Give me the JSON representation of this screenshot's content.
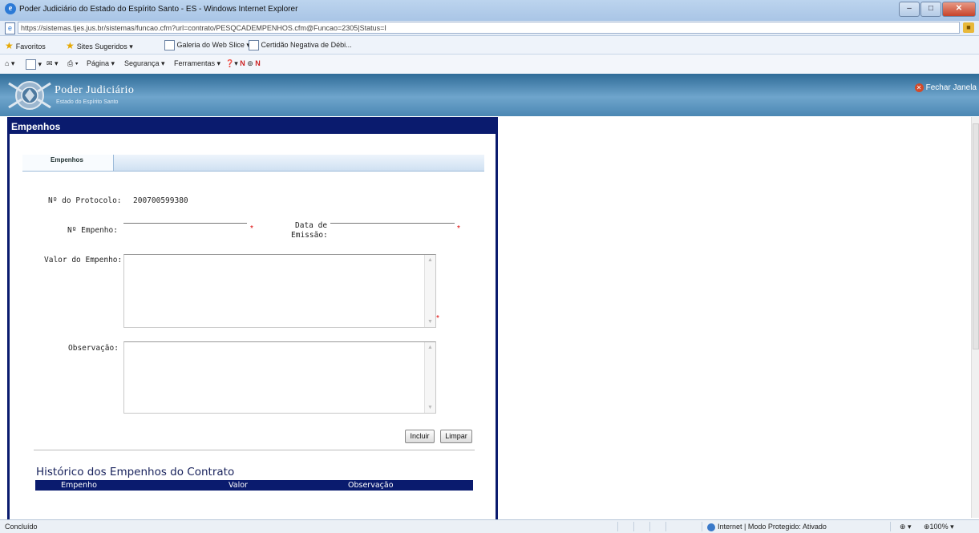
{
  "browser": {
    "window_title": "Poder Judiciário do Estado do Espírito Santo - ES - Windows Internet Explorer",
    "url": "https://sistemas.tjes.jus.br/sistemas/funcao.cfm?url=contrato/PESQCADEMPENHOS.cfm@Funcao=2305|Status=I",
    "favorites": {
      "label": "Favoritos",
      "items": [
        "Sites Sugeridos ▾",
        "Galeria do Web Slice ▾",
        "Certidão Negativa de Débi..."
      ]
    },
    "command": {
      "pagina": "Página ▾",
      "seguranca": "Segurança ▾",
      "ferramentas": "Ferramentas ▾"
    },
    "status": {
      "left": "Concluído",
      "zone": "Internet | Modo Protegido: Ativado",
      "zoom": "100%"
    }
  },
  "app": {
    "title": "Poder Judiciário",
    "subtitle": "Estado do Espírito Santo",
    "close_label": "Fechar Janela"
  },
  "panel": {
    "title": "Empenhos",
    "tab": "Empenhos",
    "protocolo_label": "Nº do Protocolo:",
    "protocolo_value": "200700599380",
    "empenho_label": "Nº Empenho:",
    "data_label_1": "Data de",
    "data_label_2": "Emissão:",
    "valor_label": "Valor do Empenho:",
    "obs_label": "Observação:",
    "required_mark": "*",
    "incluir": "Incluir",
    "limpar": "Limpar",
    "history_title": "Histórico dos Empenhos do Contrato",
    "history_columns": [
      "Empenho",
      "Valor",
      "Observação"
    ]
  }
}
